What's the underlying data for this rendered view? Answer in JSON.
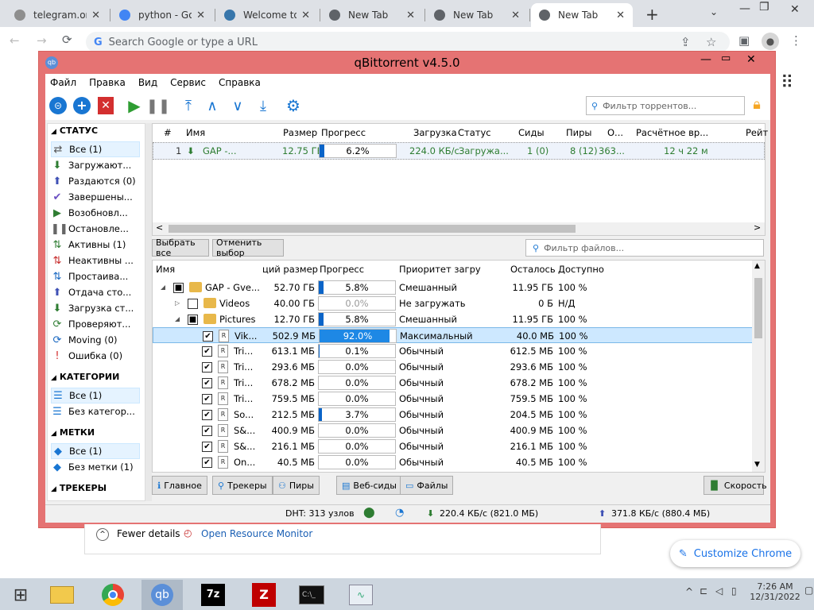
{
  "chrome": {
    "tabs": [
      {
        "title": "telegram.org",
        "fav": "#8e8e8e"
      },
      {
        "title": "python - Go",
        "fav": "#4285f4"
      },
      {
        "title": "Welcome to",
        "fav": "#3776ab"
      },
      {
        "title": "New Tab",
        "fav": "#5f6368"
      },
      {
        "title": "New Tab",
        "fav": "#5f6368"
      },
      {
        "title": "New Tab",
        "fav": "#5f6368"
      }
    ],
    "omnibox_placeholder": "Search Google or type a URL",
    "fewer_details": "Fewer details",
    "open_resource_monitor": "Open Resource Monitor",
    "customize_chrome": "Customize Chrome"
  },
  "qb": {
    "title": "qBittorrent v4.5.0",
    "menu": [
      "Файл",
      "Правка",
      "Вид",
      "Сервис",
      "Справка"
    ],
    "filter_placeholder": "Фильтр торрентов...",
    "sidebar": {
      "status_header": "СТАТУС",
      "status_items": [
        {
          "label": "Все (1)",
          "icon": "⇄",
          "color": "#555"
        },
        {
          "label": "Загружают...",
          "icon": "⬇",
          "color": "#2e7d32"
        },
        {
          "label": "Раздаются (0)",
          "icon": "⬆",
          "color": "#3f51b5"
        },
        {
          "label": "Завершены...",
          "icon": "✔",
          "color": "#6a4fc2"
        },
        {
          "label": "Возобновл...",
          "icon": "▶",
          "color": "#2e7d32"
        },
        {
          "label": "Остановле...",
          "icon": "❚❚",
          "color": "#666"
        },
        {
          "label": "Активны (1)",
          "icon": "⇅",
          "color": "#2e7d32"
        },
        {
          "label": "Неактивны ...",
          "icon": "⇅",
          "color": "#c62828"
        },
        {
          "label": "Простаива...",
          "icon": "⇅",
          "color": "#1565c0"
        },
        {
          "label": "Отдача сто...",
          "icon": "⬆",
          "color": "#3f51b5"
        },
        {
          "label": "Загрузка ст...",
          "icon": "⬇",
          "color": "#2e7d32"
        },
        {
          "label": "Проверяют...",
          "icon": "⟳",
          "color": "#2e7d32"
        },
        {
          "label": "Moving (0)",
          "icon": "⟳",
          "color": "#1565c0"
        },
        {
          "label": "Ошибка (0)",
          "icon": "!",
          "color": "#d32f2f"
        }
      ],
      "categories_header": "КАТЕГОРИИ",
      "category_items": [
        {
          "label": "Все (1)"
        },
        {
          "label": "Без категор..."
        }
      ],
      "tags_header": "МЕТКИ",
      "tag_items": [
        {
          "label": "Все (1)"
        },
        {
          "label": "Без метки (1)"
        }
      ],
      "trackers_header": "ТРЕКЕРЫ"
    },
    "torrent_headers": [
      "#",
      "Имя",
      "Размер",
      "Прогресс",
      "Загрузка",
      "Статус",
      "Сиды",
      "Пиры",
      "О...",
      "Расчётное вр...",
      "Рейт"
    ],
    "torrent": {
      "num": "1",
      "name": "GAP -...",
      "size": "12.75 ГБ",
      "progress_label": "6.2%",
      "progress": 0.062,
      "down": "224.0 КБ/с",
      "status": "Загружа...",
      "seeds": "1 (0)",
      "peers": "8 (12)",
      "ratio": "363...",
      "eta": "12 ч 22 м"
    },
    "select_all": "Выбрать все",
    "deselect": "Отменить выбор",
    "file_filter_placeholder": "Фильтр файлов...",
    "file_headers": [
      "Имя",
      "ций размер",
      "Прогресс",
      "Приоритет загру",
      "Осталось",
      "Доступно"
    ],
    "files": [
      {
        "name": "GAP - Gve...",
        "size": "52.70 ГБ",
        "progress_label": "5.8%",
        "progress": 0.058,
        "priority": "Смешанный",
        "remaining": "11.95 ГБ",
        "avail": "100 %",
        "kind": "folder",
        "check": "■",
        "indent": 0,
        "expander": "◢",
        "grey": false,
        "selected": false
      },
      {
        "name": "Videos",
        "size": "40.00 ГБ",
        "progress_label": "0.0%",
        "progress": 0.0,
        "priority": "Не загружать",
        "remaining": "0 Б",
        "avail": "Н/Д",
        "kind": "folder",
        "check": "",
        "indent": 1,
        "expander": "▷",
        "grey": true,
        "selected": false
      },
      {
        "name": "Pictures",
        "size": "12.70 ГБ",
        "progress_label": "5.8%",
        "progress": 0.058,
        "priority": "Смешанный",
        "remaining": "11.95 ГБ",
        "avail": "100 %",
        "kind": "folder",
        "check": "■",
        "indent": 1,
        "expander": "◢",
        "grey": false,
        "selected": false
      },
      {
        "name": "Vik...",
        "size": "502.9 МБ",
        "progress_label": "92.0%",
        "progress": 0.92,
        "priority": "Максимальный",
        "remaining": "40.0 МБ",
        "avail": "100 %",
        "kind": "file",
        "check": "✔",
        "indent": 2,
        "expander": "",
        "grey": false,
        "selected": true
      },
      {
        "name": "Tri...",
        "size": "613.1 МБ",
        "progress_label": "0.1%",
        "progress": 0.001,
        "priority": "Обычный",
        "remaining": "612.5 МБ",
        "avail": "100 %",
        "kind": "file",
        "check": "✔",
        "indent": 2,
        "expander": "",
        "grey": false,
        "selected": false
      },
      {
        "name": "Tri...",
        "size": "293.6 МБ",
        "progress_label": "0.0%",
        "progress": 0.0,
        "priority": "Обычный",
        "remaining": "293.6 МБ",
        "avail": "100 %",
        "kind": "file",
        "check": "✔",
        "indent": 2,
        "expander": "",
        "grey": false,
        "selected": false
      },
      {
        "name": "Tri...",
        "size": "678.2 МБ",
        "progress_label": "0.0%",
        "progress": 0.0,
        "priority": "Обычный",
        "remaining": "678.2 МБ",
        "avail": "100 %",
        "kind": "file",
        "check": "✔",
        "indent": 2,
        "expander": "",
        "grey": false,
        "selected": false
      },
      {
        "name": "Tri...",
        "size": "759.5 МБ",
        "progress_label": "0.0%",
        "progress": 0.0,
        "priority": "Обычный",
        "remaining": "759.5 МБ",
        "avail": "100 %",
        "kind": "file",
        "check": "✔",
        "indent": 2,
        "expander": "",
        "grey": false,
        "selected": false
      },
      {
        "name": "So...",
        "size": "212.5 МБ",
        "progress_label": "3.7%",
        "progress": 0.037,
        "priority": "Обычный",
        "remaining": "204.5 МБ",
        "avail": "100 %",
        "kind": "file",
        "check": "✔",
        "indent": 2,
        "expander": "",
        "grey": false,
        "selected": false
      },
      {
        "name": "S&...",
        "size": "400.9 МБ",
        "progress_label": "0.0%",
        "progress": 0.0,
        "priority": "Обычный",
        "remaining": "400.9 МБ",
        "avail": "100 %",
        "kind": "file",
        "check": "✔",
        "indent": 2,
        "expander": "",
        "grey": false,
        "selected": false
      },
      {
        "name": "S&...",
        "size": "216.1 МБ",
        "progress_label": "0.0%",
        "progress": 0.0,
        "priority": "Обычный",
        "remaining": "216.1 МБ",
        "avail": "100 %",
        "kind": "file",
        "check": "✔",
        "indent": 2,
        "expander": "",
        "grey": false,
        "selected": false
      },
      {
        "name": "On...",
        "size": "40.5 МБ",
        "progress_label": "0.0%",
        "progress": 0.0,
        "priority": "Обычный",
        "remaining": "40.5 МБ",
        "avail": "100 %",
        "kind": "file",
        "check": "✔",
        "indent": 2,
        "expander": "",
        "grey": false,
        "selected": false
      }
    ],
    "bottom_tabs": [
      "Главное",
      "Трекеры",
      "Пиры",
      "Веб-сиды",
      "Файлы"
    ],
    "speed_button": "Скорость",
    "status": {
      "dht": "DHT: 313 узлов",
      "down": "220.4 КБ/с (821.0 МБ)",
      "up": "371.8 КБ/с (880.4 МБ)"
    }
  },
  "taskbar": {
    "time": "7:26 AM",
    "date": "12/31/2022"
  }
}
